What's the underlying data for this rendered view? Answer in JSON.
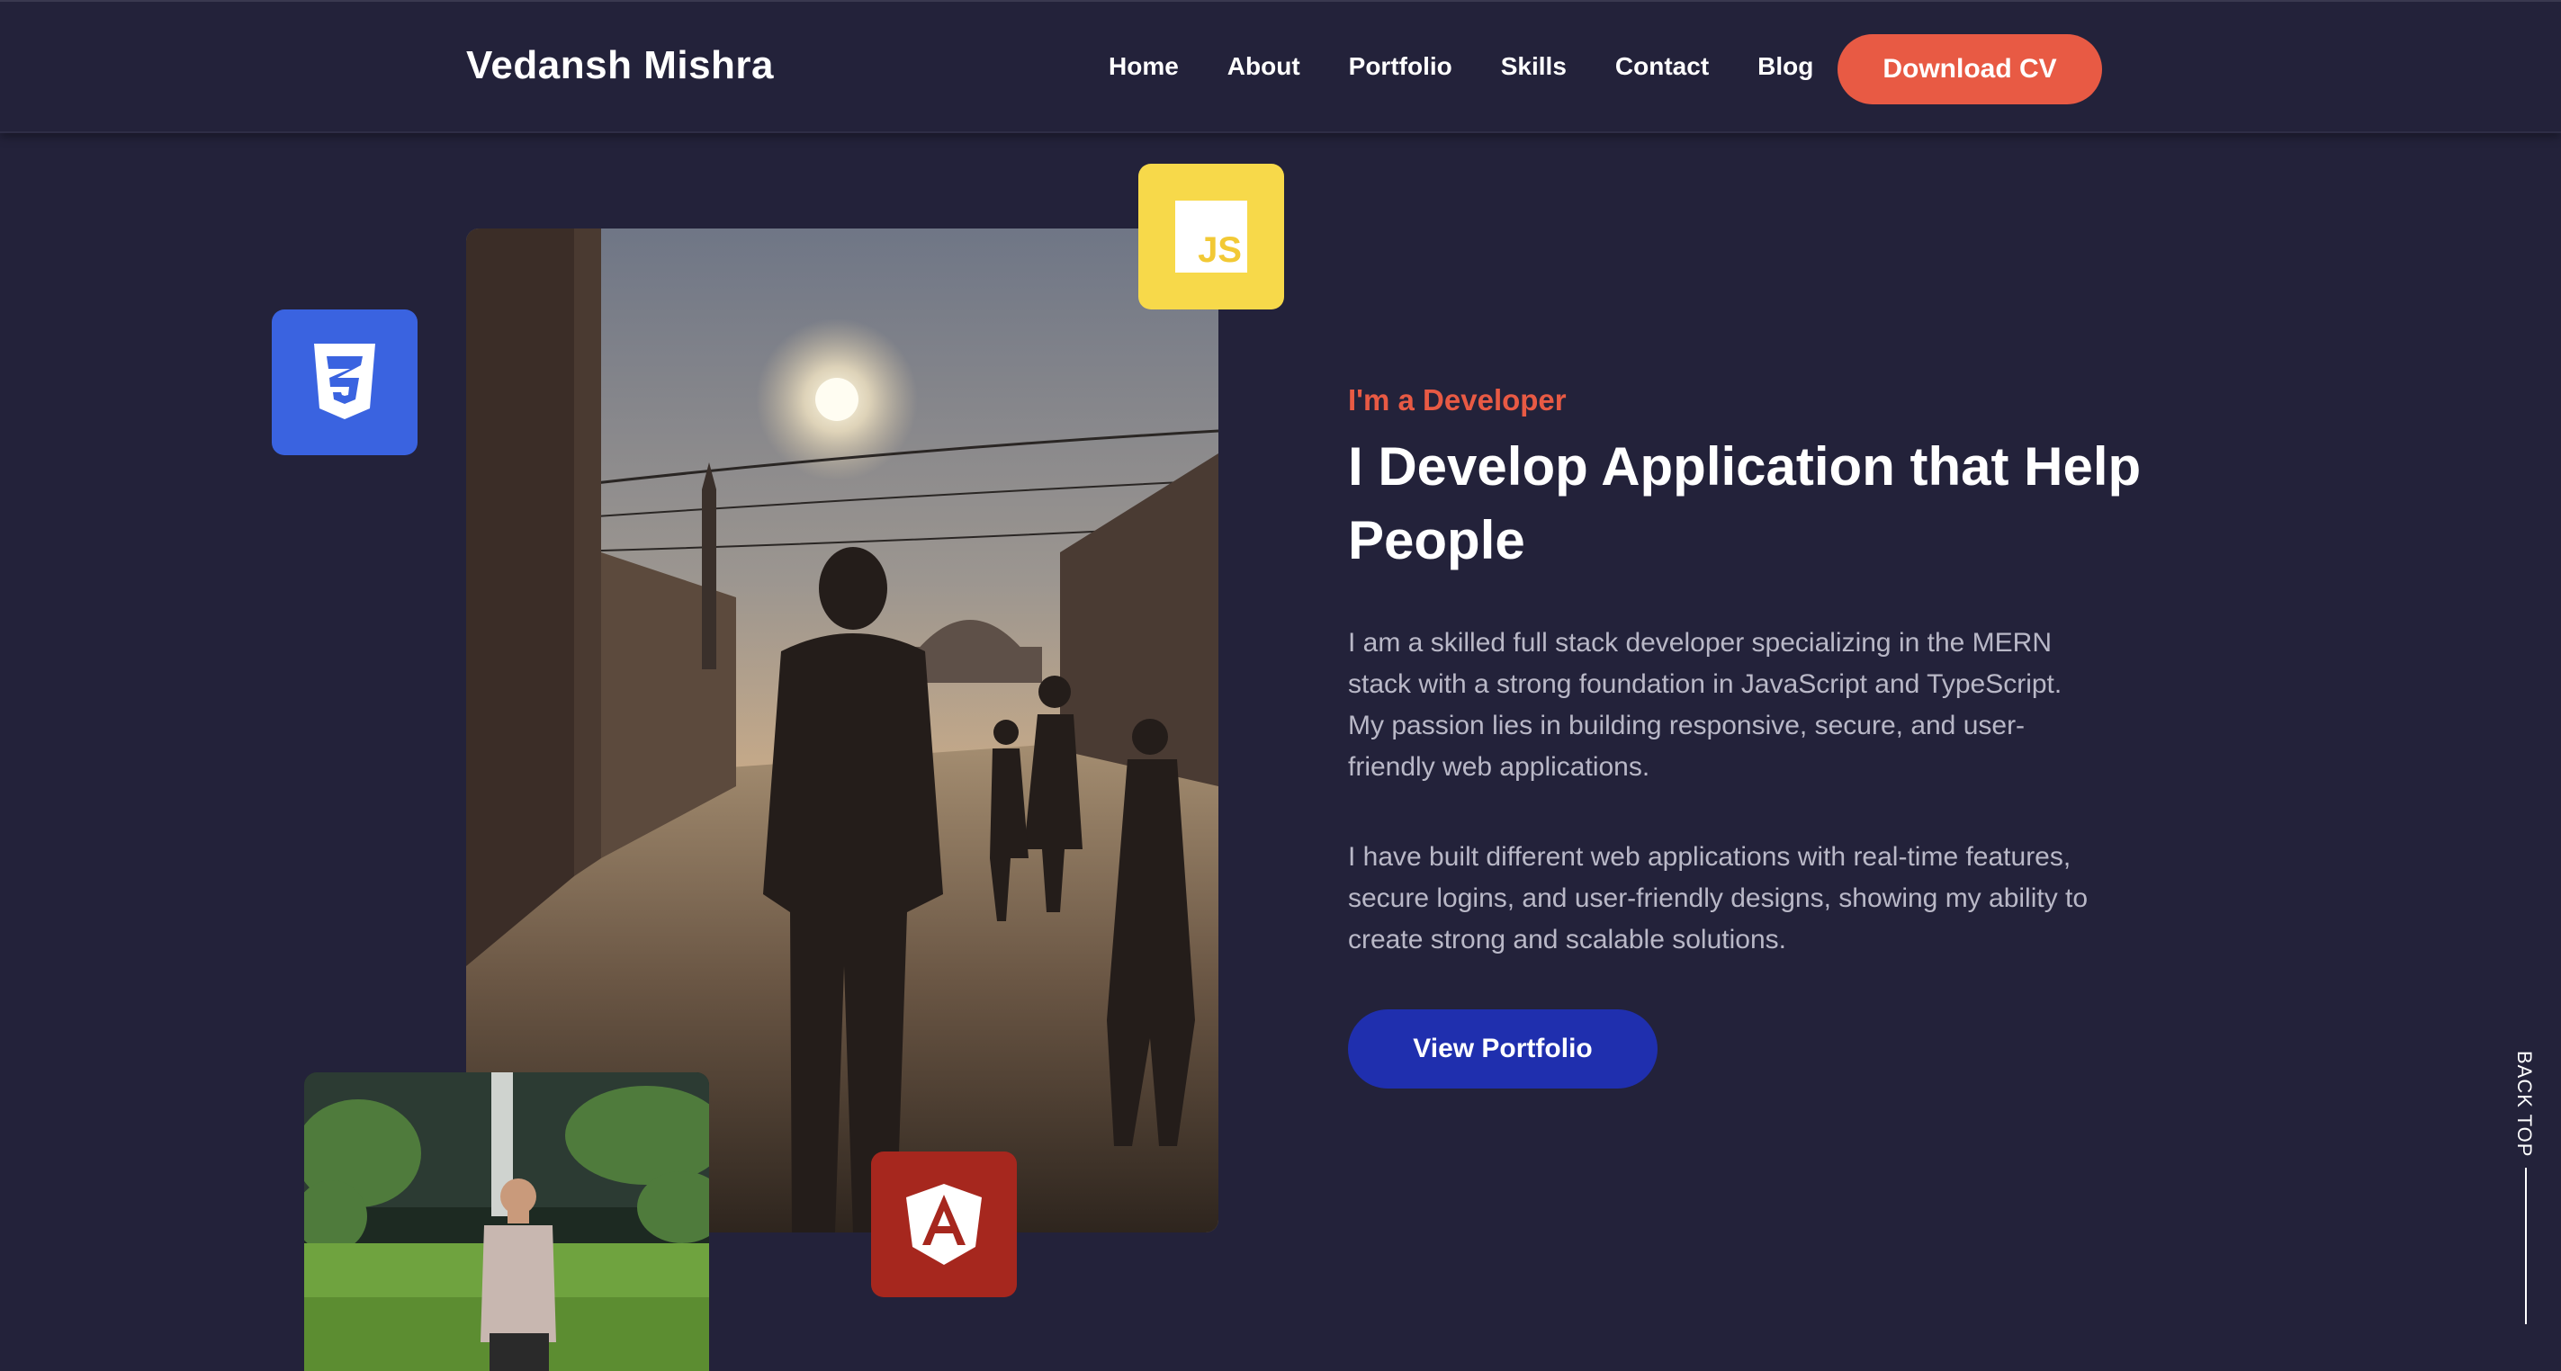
{
  "header": {
    "brand": "Vedansh Mishra",
    "nav": [
      "Home",
      "About",
      "Portfolio",
      "Skills",
      "Contact",
      "Blog"
    ],
    "cta_label": "Download CV"
  },
  "icons": {
    "css": "css3-icon",
    "js_label": "JS",
    "angular": "angular-icon"
  },
  "hero": {
    "eyebrow": "I'm a Developer",
    "headline": "I Develop Application that Help People",
    "paragraph1": "I am a skilled full stack developer specializing in the MERN stack with a strong foundation in JavaScript and TypeScript. My passion lies in building responsive, secure, and user-friendly web applications.",
    "paragraph2": "I have built different web applications with real-time features, secure logins, and user-friendly designs, showing my ability to create strong and scalable solutions.",
    "button_label": "View Portfolio"
  },
  "back_top": "BACK TOP",
  "colors": {
    "background": "#23223a",
    "accent": "#e85a44",
    "primary_button": "#1f2fae",
    "css_badge": "#3a63e0",
    "js_badge": "#f7d94a",
    "angular_badge": "#a6271e"
  }
}
